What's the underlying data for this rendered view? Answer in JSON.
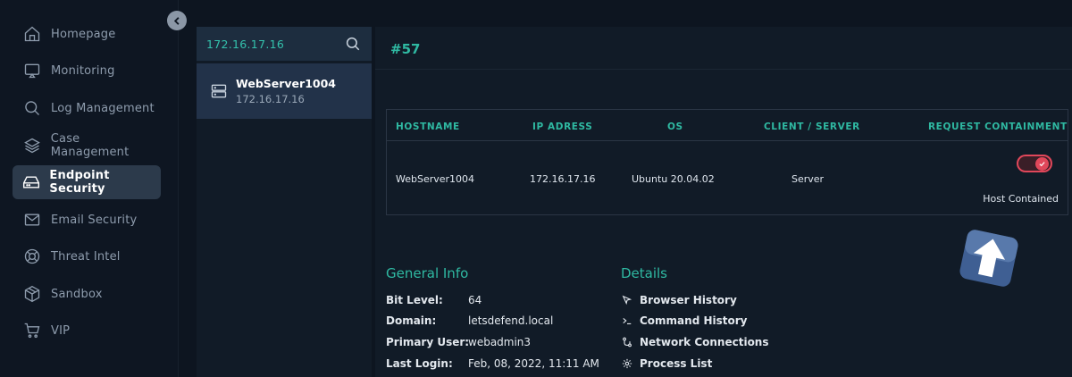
{
  "sidebar": {
    "items": [
      {
        "label": "Homepage",
        "icon": "home-icon"
      },
      {
        "label": "Monitoring",
        "icon": "monitor-icon"
      },
      {
        "label": "Log Management",
        "icon": "search-icon"
      },
      {
        "label": "Case Management",
        "icon": "layers-icon"
      },
      {
        "label": "Endpoint Security",
        "icon": "hard-drive-icon",
        "active": true
      },
      {
        "label": "Email Security",
        "icon": "mail-icon"
      },
      {
        "label": "Threat Intel",
        "icon": "lifebuoy-icon"
      },
      {
        "label": "Sandbox",
        "icon": "package-icon"
      },
      {
        "label": "VIP",
        "icon": "cart-icon"
      }
    ]
  },
  "search": {
    "value": "172.16.17.16"
  },
  "hosts": [
    {
      "name": "WebServer1004",
      "ip": "172.16.17.16"
    }
  ],
  "case": {
    "id": "#57"
  },
  "table": {
    "headers": {
      "hostname": "HOSTNAME",
      "ip": "IP ADRESS",
      "os": "OS",
      "client_server": "CLIENT / SERVER",
      "containment": "REQUEST CONTAINMENT"
    },
    "row": {
      "hostname": "WebServer1004",
      "ip": "172.16.17.16",
      "os": "Ubuntu 20.04.02",
      "client_server": "Server",
      "containment_on": true,
      "containment_status": "Host Contained"
    }
  },
  "general": {
    "title": "General Info",
    "rows": [
      {
        "key": "Bit Level:",
        "value": "64"
      },
      {
        "key": "Domain:",
        "value": "letsdefend.local"
      },
      {
        "key": "Primary User:",
        "value": "webadmin3"
      },
      {
        "key": "Last Login:",
        "value": "Feb, 08, 2022, 11:11 AM"
      }
    ]
  },
  "details": {
    "title": "Details",
    "items": [
      {
        "label": "Browser History",
        "icon": "cursor-icon"
      },
      {
        "label": "Command History",
        "icon": "terminal-icon"
      },
      {
        "label": "Network Connections",
        "icon": "network-icon"
      },
      {
        "label": "Process List",
        "icon": "gear-icon"
      }
    ]
  },
  "colors": {
    "accent": "#2fb9a2",
    "danger": "#e0475a",
    "sidebar_active": "#2c3a4b"
  }
}
